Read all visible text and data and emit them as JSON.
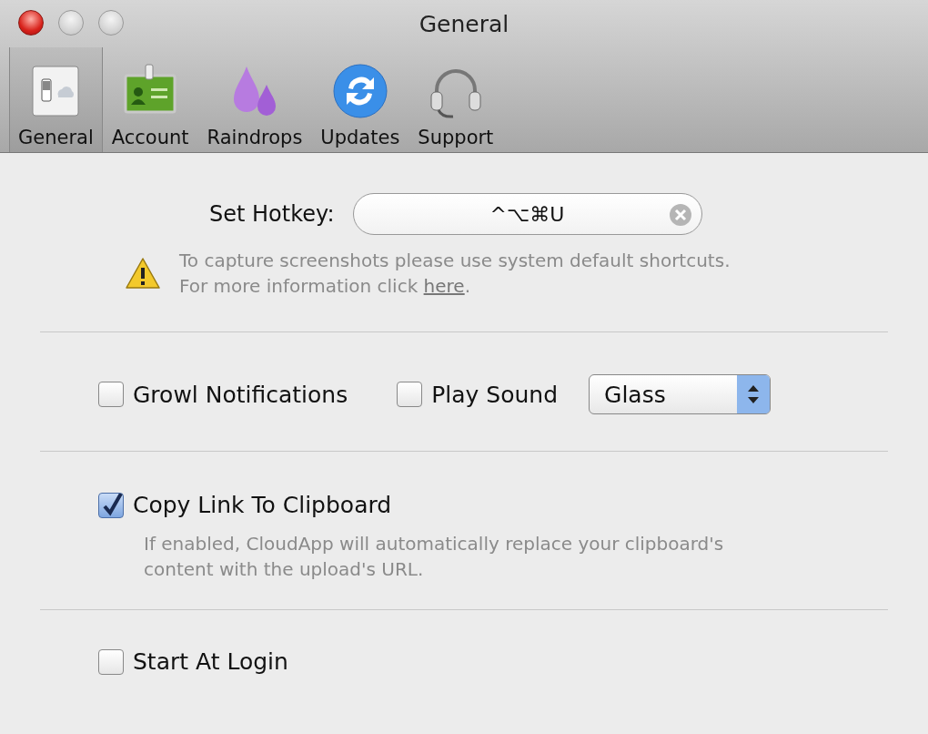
{
  "window": {
    "title": "General"
  },
  "toolbar": {
    "tabs": [
      {
        "label": "General",
        "kind": "switch",
        "selected": true
      },
      {
        "label": "Account",
        "kind": "badge",
        "selected": false
      },
      {
        "label": "Raindrops",
        "kind": "drops",
        "selected": false
      },
      {
        "label": "Updates",
        "kind": "refresh",
        "selected": false
      },
      {
        "label": "Support",
        "kind": "headset",
        "selected": false
      }
    ]
  },
  "hotkey": {
    "label": "Set Hotkey:",
    "value": "^⌥⌘U"
  },
  "notice": {
    "line_1": "To capture screenshots please use system default shortcuts.",
    "line_2": "For more information click ",
    "link": "here",
    "line_end": "."
  },
  "sections": [
    {
      "items": [
        {
          "kind": "checkbox",
          "label": "Growl Notifications",
          "checked": false
        },
        {
          "kind": "checkbox",
          "label": "Play Sound",
          "checked": false
        },
        {
          "kind": "popup",
          "value": "Glass"
        }
      ]
    },
    {
      "items": [
        {
          "kind": "checkbox",
          "label": "Copy Link To Clipboard",
          "checked": true
        }
      ],
      "description_lines": [
        "If enabled, CloudApp will automatically replace your clipboard's",
        "content with the upload's URL."
      ]
    },
    {
      "items": [
        {
          "kind": "checkbox",
          "label": "Start At Login",
          "checked": false
        }
      ]
    }
  ]
}
